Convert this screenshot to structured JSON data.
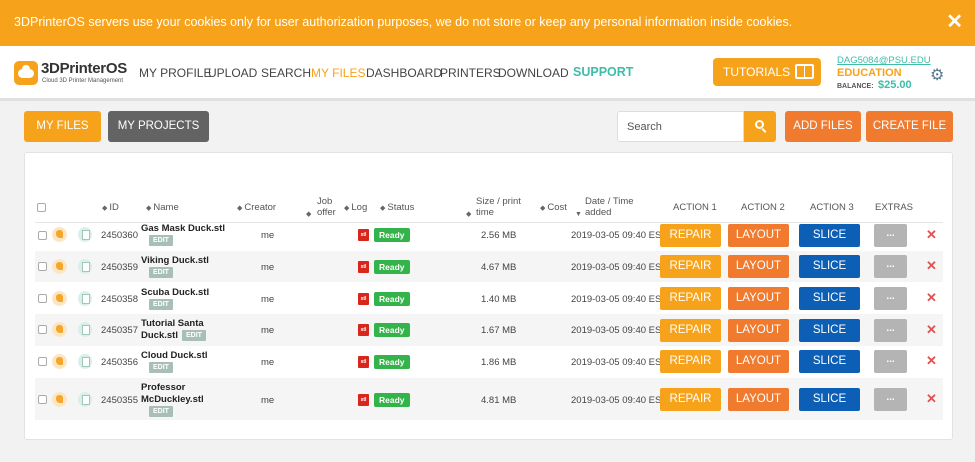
{
  "cookie": {
    "text": "3DPrinterOS servers use your cookies only for user authorization purposes, we do not store or keep any personal information inside cookies.",
    "close": "✕"
  },
  "header": {
    "logo_title": "3DPrinterOS",
    "logo_sub": "Cloud 3D Printer Management",
    "nav": [
      "MY PROFILE",
      "UPLOAD",
      "SEARCH",
      "MY FILES",
      "DASHBOARD",
      "PRINTERS",
      "DOWNLOAD",
      "SUPPORT"
    ],
    "active_nav": "MY FILES",
    "tutorials": "TUTORIALS",
    "user_email": "DAG5084@PSU.EDU",
    "plan": "EDUCATION",
    "balance_label": "BALANCE:",
    "balance_value": "$25.00",
    "gear": "⚙"
  },
  "toolbar": {
    "my_files": "MY FILES",
    "my_projects": "MY PROJECTS",
    "search_placeholder": "Search",
    "add_files": "ADD FILES",
    "create_file": "CREATE FILE"
  },
  "table": {
    "headers": {
      "id": "ID",
      "name": "Name",
      "creator": "Creator",
      "job_offer": "Job offer",
      "log": "Log",
      "status": "Status",
      "size": "Size / print time",
      "cost": "Cost",
      "date": "Date / Time added",
      "action1": "ACTION 1",
      "action2": "ACTION 2",
      "action3": "ACTION 3",
      "extras": "EXTRAS"
    },
    "rows": [
      {
        "id": "2450360",
        "name_line1": "Gas Mask Duck.stl",
        "name_line2": "",
        "creator": "me",
        "status": "Ready",
        "size": "2.56 MB",
        "date": "2019-03-05 09:40 EST"
      },
      {
        "id": "2450359",
        "name_line1": "Viking Duck.stl",
        "name_line2": "",
        "creator": "me",
        "status": "Ready",
        "size": "4.67 MB",
        "date": "2019-03-05 09:40 EST"
      },
      {
        "id": "2450358",
        "name_line1": "Scuba Duck.stl",
        "name_line2": "",
        "creator": "me",
        "status": "Ready",
        "size": "1.40 MB",
        "date": "2019-03-05 09:40 EST"
      },
      {
        "id": "2450357",
        "name_line1": "Tutorial Santa",
        "name_line2": "Duck.stl",
        "creator": "me",
        "status": "Ready",
        "size": "1.67 MB",
        "date": "2019-03-05 09:40 EST"
      },
      {
        "id": "2450356",
        "name_line1": "Cloud Duck.stl",
        "name_line2": "",
        "creator": "me",
        "status": "Ready",
        "size": "1.86 MB",
        "date": "2019-03-05 09:40 EST"
      },
      {
        "id": "2450355",
        "name_line1": "Professor",
        "name_line2": "McDuckley.stl",
        "creator": "me",
        "status": "Ready",
        "size": "4.81 MB",
        "date": "2019-03-05 09:40 EST"
      }
    ],
    "edit_label": "EDIT",
    "log_label": "stl",
    "repair_label": "REPAIR",
    "layout_label": "LAYOUT",
    "slice_label": "SLICE",
    "extras_label": "...",
    "delete_label": "✕"
  },
  "colors": {
    "orange": "#f7a21b",
    "dark_orange": "#f07a2e",
    "teal": "#3dbda8",
    "blue": "#0d5fb6",
    "green": "#34b34a",
    "red": "#d9261c"
  }
}
